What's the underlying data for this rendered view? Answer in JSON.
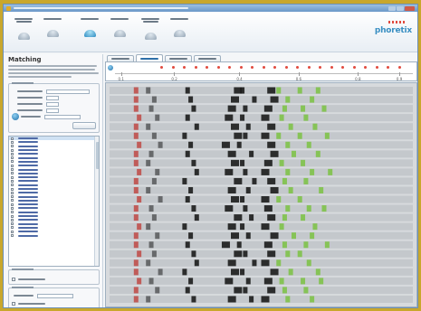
{
  "header": {
    "logo_text": "phoretix",
    "module_count": 7,
    "active_module": 2
  },
  "page": {
    "title": "Matching"
  },
  "lanes": {
    "count": 26,
    "selected_index": 0
  },
  "ruler": {
    "ticks": [
      "0.1",
      "0.2",
      "0.4",
      "0.6",
      "0.8",
      "0.9"
    ]
  },
  "gel": {
    "lanes": 24,
    "bands": [
      [
        0.08,
        0.12,
        0.25,
        0.41,
        0.43,
        0.52,
        0.55,
        0.62,
        0.68
      ],
      [
        0.08,
        0.14,
        0.26,
        0.4,
        0.47,
        0.53,
        0.58,
        0.66
      ],
      [
        0.08,
        0.13,
        0.27,
        0.39,
        0.44,
        0.51,
        0.57,
        0.63,
        0.7
      ],
      [
        0.09,
        0.15,
        0.25,
        0.38,
        0.43,
        0.5,
        0.56,
        0.64
      ],
      [
        0.08,
        0.12,
        0.28,
        0.4,
        0.45,
        0.52,
        0.59,
        0.67
      ],
      [
        0.08,
        0.14,
        0.24,
        0.41,
        0.44,
        0.5,
        0.55,
        0.62,
        0.71
      ],
      [
        0.09,
        0.16,
        0.26,
        0.37,
        0.42,
        0.52,
        0.58,
        0.65
      ],
      [
        0.08,
        0.13,
        0.25,
        0.39,
        0.46,
        0.53,
        0.6,
        0.68
      ],
      [
        0.08,
        0.12,
        0.27,
        0.4,
        0.43,
        0.51,
        0.56,
        0.63
      ],
      [
        0.09,
        0.15,
        0.28,
        0.38,
        0.44,
        0.5,
        0.58,
        0.66,
        0.72
      ],
      [
        0.08,
        0.14,
        0.24,
        0.41,
        0.47,
        0.52,
        0.57,
        0.64
      ],
      [
        0.08,
        0.12,
        0.26,
        0.39,
        0.45,
        0.53,
        0.59,
        0.69
      ],
      [
        0.09,
        0.16,
        0.25,
        0.4,
        0.43,
        0.5,
        0.55,
        0.62
      ],
      [
        0.08,
        0.13,
        0.27,
        0.38,
        0.44,
        0.51,
        0.58,
        0.65,
        0.7
      ],
      [
        0.08,
        0.14,
        0.28,
        0.41,
        0.46,
        0.52,
        0.57,
        0.63
      ],
      [
        0.09,
        0.12,
        0.24,
        0.39,
        0.43,
        0.5,
        0.56,
        0.67
      ],
      [
        0.08,
        0.15,
        0.26,
        0.4,
        0.45,
        0.53,
        0.6,
        0.66
      ],
      [
        0.08,
        0.13,
        0.25,
        0.37,
        0.42,
        0.51,
        0.57,
        0.64,
        0.71
      ],
      [
        0.09,
        0.14,
        0.27,
        0.41,
        0.44,
        0.52,
        0.58,
        0.62
      ],
      [
        0.08,
        0.12,
        0.28,
        0.39,
        0.47,
        0.5,
        0.55,
        0.65
      ],
      [
        0.08,
        0.16,
        0.24,
        0.4,
        0.43,
        0.53,
        0.59,
        0.68
      ],
      [
        0.09,
        0.13,
        0.26,
        0.38,
        0.45,
        0.51,
        0.56,
        0.63,
        0.69
      ],
      [
        0.08,
        0.15,
        0.25,
        0.41,
        0.44,
        0.52,
        0.57,
        0.64
      ],
      [
        0.08,
        0.12,
        0.27,
        0.39,
        0.46,
        0.5,
        0.58,
        0.66
      ]
    ],
    "colors": {
      "dark_band": "#1c1c1c",
      "match_band": "#7fc24a",
      "marker_band": "#c0504d",
      "lane_bg": "#c4c8cc"
    }
  },
  "theme": {
    "accent": "#2c8cc2",
    "outer_bg": "#c9a72c"
  }
}
